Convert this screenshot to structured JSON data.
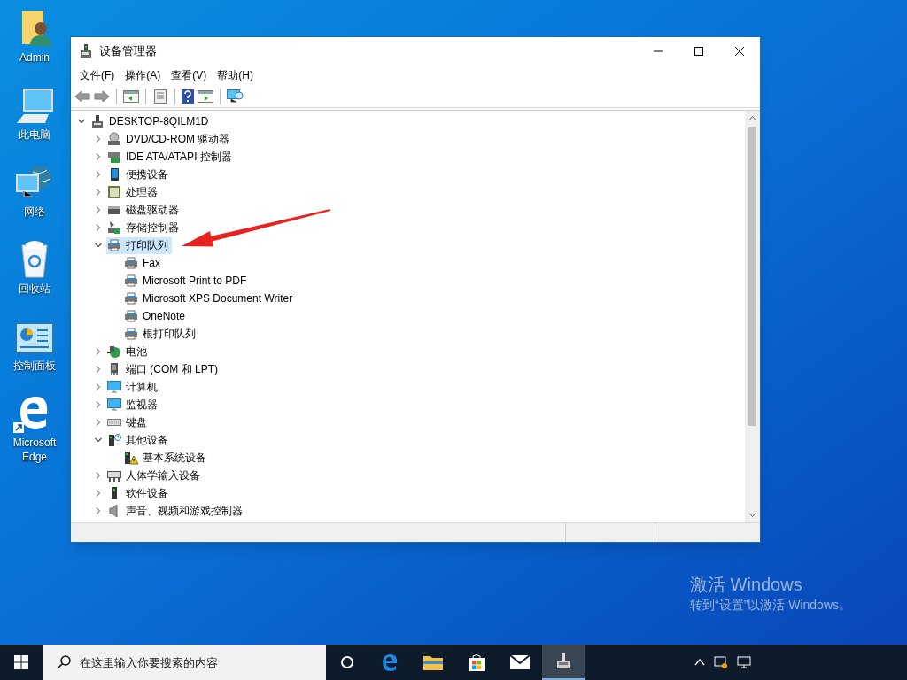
{
  "desktop_icons": [
    {
      "label": "Admin"
    },
    {
      "label": "此电脑"
    },
    {
      "label": "网络"
    },
    {
      "label": "回收站"
    },
    {
      "label": "控制面板"
    },
    {
      "label": "Microsoft Edge"
    }
  ],
  "window": {
    "title": "设备管理器"
  },
  "menu": [
    "文件(F)",
    "操作(A)",
    "查看(V)",
    "帮助(H)"
  ],
  "tree": {
    "label": "DESKTOP-8QILM1D",
    "expanded": true,
    "selected": false,
    "children": [
      {
        "label": "DVD/CD-ROM 驱动器",
        "expanded": false,
        "selected": false
      },
      {
        "label": "IDE ATA/ATAPI 控制器",
        "expanded": false,
        "selected": false
      },
      {
        "label": "便携设备",
        "expanded": false,
        "selected": false
      },
      {
        "label": "处理器",
        "expanded": false,
        "selected": false
      },
      {
        "label": "磁盘驱动器",
        "expanded": false,
        "selected": false
      },
      {
        "label": "存储控制器",
        "expanded": false,
        "selected": false
      },
      {
        "label": "打印队列",
        "expanded": true,
        "selected": true,
        "children": [
          {
            "label": "Fax",
            "selected": false
          },
          {
            "label": "Microsoft Print to PDF",
            "selected": false
          },
          {
            "label": "Microsoft XPS Document Writer",
            "selected": false
          },
          {
            "label": "OneNote",
            "selected": false
          },
          {
            "label": "根打印队列",
            "selected": false
          }
        ]
      },
      {
        "label": "电池",
        "expanded": false,
        "selected": false
      },
      {
        "label": "端口 (COM 和 LPT)",
        "expanded": false,
        "selected": false
      },
      {
        "label": "计算机",
        "expanded": false,
        "selected": false
      },
      {
        "label": "监视器",
        "expanded": false,
        "selected": false
      },
      {
        "label": "键盘",
        "expanded": false,
        "selected": false
      },
      {
        "label": "其他设备",
        "expanded": true,
        "selected": false,
        "children": [
          {
            "label": "基本系统设备",
            "selected": false
          }
        ]
      },
      {
        "label": "人体学输入设备",
        "expanded": false,
        "selected": false
      },
      {
        "label": "软件设备",
        "expanded": false,
        "selected": false
      },
      {
        "label": "声音、视频和游戏控制器",
        "expanded": false,
        "selected": false
      }
    ]
  },
  "activation": {
    "title": "激活 Windows",
    "message": "转到“设置”以激活 Windows。"
  },
  "taskbar": {
    "search": {
      "placeholder": "在这里输入你要搜索的内容"
    }
  }
}
